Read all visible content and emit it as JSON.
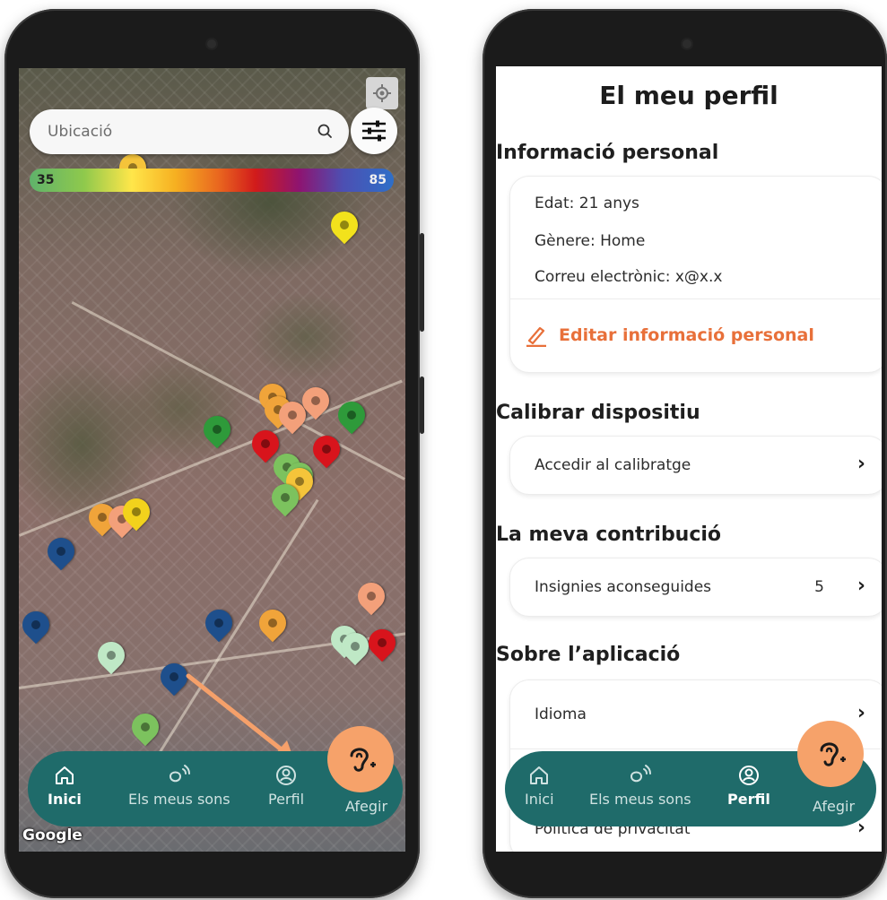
{
  "map_screen": {
    "search": {
      "placeholder": "Ubicació"
    },
    "scale": {
      "min": "35",
      "max": "85"
    },
    "google_logo": "Google",
    "pins": [
      {
        "color": "#f5c43a"
      },
      {
        "color": "#f2e21c"
      },
      {
        "color": "#f0a43a"
      },
      {
        "color": "#f0a43a"
      },
      {
        "color": "#f3a07a"
      },
      {
        "color": "#f3a07a"
      },
      {
        "color": "#2e9a3a"
      },
      {
        "color": "#2e9a3a"
      },
      {
        "color": "#d8141c"
      },
      {
        "color": "#d8141c"
      },
      {
        "color": "#7cc25e"
      },
      {
        "color": "#7cc25e"
      },
      {
        "color": "#f5c43a"
      },
      {
        "color": "#7cc25e"
      },
      {
        "color": "#f0a43a"
      },
      {
        "color": "#f3a07a"
      },
      {
        "color": "#f2d21c"
      },
      {
        "color": "#1e4f8c"
      },
      {
        "color": "#1e4f8c"
      },
      {
        "color": "#1e4f8c"
      },
      {
        "color": "#f0a43a"
      },
      {
        "color": "#bfe8c6"
      },
      {
        "color": "#1e4f8c"
      },
      {
        "color": "#f3a07a"
      },
      {
        "color": "#bfe8c6"
      },
      {
        "color": "#bfe8c6"
      },
      {
        "color": "#d8141c"
      },
      {
        "color": "#7cc25e"
      }
    ]
  },
  "nav": {
    "home_label": "Inici",
    "sounds_label": "Els meus sons",
    "profile_label": "Perfil",
    "add_label": "Afegir"
  },
  "profile": {
    "title": "El meu perfil",
    "personal_section": "Informació personal",
    "age": "Edat: 21 anys",
    "gender": "Gènere: Home",
    "email": "Correu electrònic: x@x.x",
    "edit_label": "Editar informació personal",
    "calibrate_section": "Calibrar dispositiu",
    "calibrate_row": "Accedir al calibratge",
    "contribution_section": "La meva contribució",
    "badges_row": "Insignies aconseguides",
    "badges_count": "5",
    "about_section": "Sobre l’aplicació",
    "language_row": "Idioma",
    "privacy_row": "Política de privacitat"
  },
  "colors": {
    "nav_bg": "#1f6b6a",
    "accent": "#e8703a",
    "fab": "#f6a26a"
  }
}
